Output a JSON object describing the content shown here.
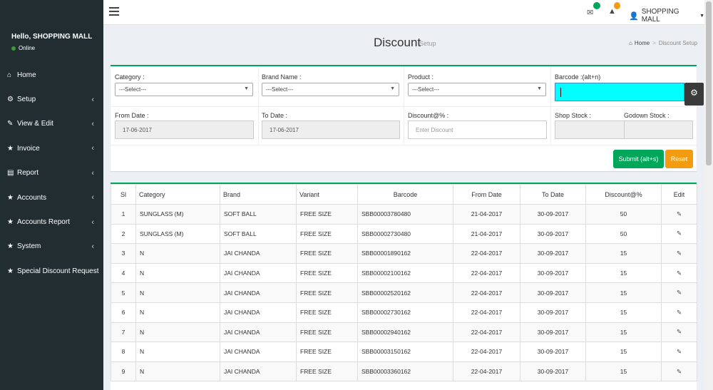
{
  "sidebar": {
    "greeting": "Hello, SHOPPING MALL",
    "status": "Online",
    "items": [
      {
        "label": "Home",
        "icon": "home-icon",
        "glyph": "⌂",
        "caret": ""
      },
      {
        "label": "Setup",
        "icon": "cogs-icon",
        "glyph": "⚙",
        "caret": "‹"
      },
      {
        "label": "View & Edit",
        "icon": "edit-icon",
        "glyph": "✎",
        "caret": "‹"
      },
      {
        "label": "Invoice",
        "icon": "star-icon",
        "glyph": "★",
        "caret": "‹"
      },
      {
        "label": "Report",
        "icon": "file-icon",
        "glyph": "▤",
        "caret": "‹"
      },
      {
        "label": "Accounts",
        "icon": "star-icon",
        "glyph": "★",
        "caret": "‹"
      },
      {
        "label": "Accounts Report",
        "icon": "star-icon",
        "glyph": "★",
        "caret": "‹"
      },
      {
        "label": "System",
        "icon": "star-icon",
        "glyph": "★",
        "caret": "‹"
      },
      {
        "label": "Special Discount Request",
        "icon": "star-icon",
        "glyph": "★",
        "caret": ""
      }
    ]
  },
  "topbar": {
    "user": "SHOPPING MALL",
    "mail_badge_color": "#00a65a",
    "warning_badge_color": "#f39c12"
  },
  "header": {
    "title": "Discount",
    "subtitle": "Setup",
    "breadcrumb_home": "Home",
    "breadcrumb_sep": ">",
    "breadcrumb_current": "Discount Setup"
  },
  "form": {
    "category_label": "Category :",
    "category_value": "---Select---",
    "brand_label": "Brand Name :",
    "brand_value": "---Select---",
    "product_label": "Product :",
    "product_value": "---Select---",
    "barcode_label": "Barcode :(alt+n)",
    "from_date_label": "From Date :",
    "from_date_value": "17-06-2017",
    "to_date_label": "To Date :",
    "to_date_value": "17-06-2017",
    "discount_label": "Discount@% :",
    "discount_placeholder": "Enter Discount",
    "shop_stock_label": "Shop Stock :",
    "godown_stock_label": "Godown Stock :",
    "submit_label": "Submit (alt+s)",
    "reset_label": "Reset"
  },
  "table": {
    "headers": {
      "sl": "Sl",
      "category": "Category",
      "brand": "Brand",
      "variant": "Variant",
      "barcode": "Barcode",
      "from_date": "From Date",
      "to_date": "To Date",
      "discount": "Discount@%",
      "edit": "Edit"
    },
    "rows": [
      {
        "sl": "1",
        "category": "SUNGLASS (M)",
        "brand": "SOFT BALL",
        "variant": "FREE SIZE",
        "barcode": "SBB00003780480",
        "from": "21-04-2017",
        "to": "30-09-2017",
        "discount": "50"
      },
      {
        "sl": "2",
        "category": "SUNGLASS (M)",
        "brand": "SOFT BALL",
        "variant": "FREE SIZE",
        "barcode": "SBB00002730480",
        "from": "21-04-2017",
        "to": "30-09-2017",
        "discount": "50"
      },
      {
        "sl": "3",
        "category": "N",
        "brand": "JAI CHANDA",
        "variant": "FREE SIZE",
        "barcode": "SBB00001890162",
        "from": "22-04-2017",
        "to": "30-09-2017",
        "discount": "15"
      },
      {
        "sl": "4",
        "category": "N",
        "brand": "JAI CHANDA",
        "variant": "FREE SIZE",
        "barcode": "SBB00002100162",
        "from": "22-04-2017",
        "to": "30-09-2017",
        "discount": "15"
      },
      {
        "sl": "5",
        "category": "N",
        "brand": "JAI CHANDA",
        "variant": "FREE SIZE",
        "barcode": "SBB00002520162",
        "from": "22-04-2017",
        "to": "30-09-2017",
        "discount": "15"
      },
      {
        "sl": "6",
        "category": "N",
        "brand": "JAI CHANDA",
        "variant": "FREE SIZE",
        "barcode": "SBB00002730162",
        "from": "22-04-2017",
        "to": "30-09-2017",
        "discount": "15"
      },
      {
        "sl": "7",
        "category": "N",
        "brand": "JAI CHANDA",
        "variant": "FREE SIZE",
        "barcode": "SBB00002940162",
        "from": "22-04-2017",
        "to": "30-09-2017",
        "discount": "15"
      },
      {
        "sl": "8",
        "category": "N",
        "brand": "JAI CHANDA",
        "variant": "FREE SIZE",
        "barcode": "SBB00003150162",
        "from": "22-04-2017",
        "to": "30-09-2017",
        "discount": "15"
      },
      {
        "sl": "9",
        "category": "N",
        "brand": "JAI CHANDA",
        "variant": "FREE SIZE",
        "barcode": "SBB00003360162",
        "from": "22-04-2017",
        "to": "30-09-2017",
        "discount": "15"
      }
    ]
  }
}
